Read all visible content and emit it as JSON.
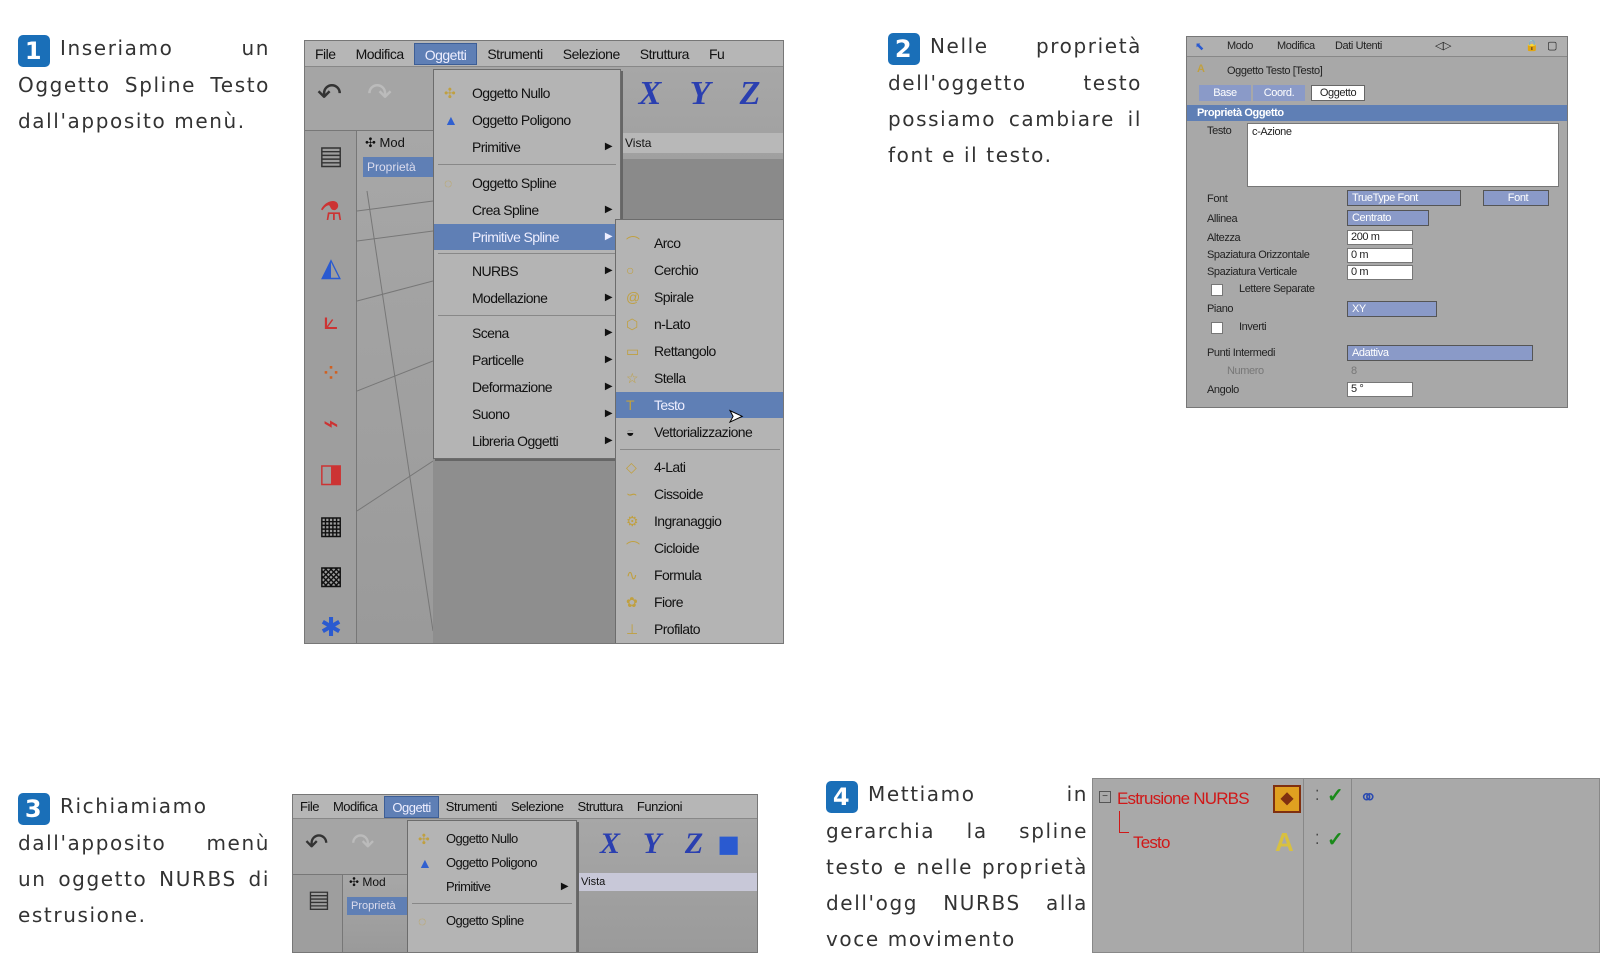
{
  "steps": [
    {
      "num": "1",
      "text": "Inseriamo un Oggetto Spline Testo dall'apposito menù."
    },
    {
      "num": "2",
      "text": "Nelle proprietà dell'oggetto testo possiamo cambiare il font e il testo."
    },
    {
      "num": "3",
      "text": "Richiamiamo dall'apposito menù un oggetto NURBS di estrusione."
    },
    {
      "num": "4",
      "text": "Mettiamo in gerarchia la spline testo e nelle proprietà dell'ogg NURBS alla voce movimento"
    }
  ],
  "menubar1": [
    "File",
    "Modifica",
    "Oggetti",
    "Strumenti",
    "Selezione",
    "Struttura",
    "Fu"
  ],
  "menubar3": [
    "File",
    "Modifica",
    "Oggetti",
    "Strumenti",
    "Selezione",
    "Struttura",
    "Funzioni"
  ],
  "viewport": {
    "tab": "Mod",
    "props_tab": "Proprietà",
    "vista": "Vista"
  },
  "axes": [
    "X",
    "Y",
    "Z"
  ],
  "oggetti_menu": [
    "Oggetto Nullo",
    "Oggetto Poligono",
    "Primitive",
    "Oggetto Spline",
    "Crea Spline",
    "Primitive Spline",
    "NURBS",
    "Modellazione",
    "Scena",
    "Particelle",
    "Deformazione",
    "Suono",
    "Libreria Oggetti"
  ],
  "spline_submenu": [
    "Arco",
    "Cerchio",
    "Spirale",
    "n-Lato",
    "Rettangolo",
    "Stella",
    "Testo",
    "Vettorializzazione",
    "4-Lati",
    "Cissoide",
    "Ingranaggio",
    "Cicloide",
    "Formula",
    "Fiore",
    "Profilato"
  ],
  "props": {
    "header": [
      "Modo",
      "Modifica",
      "Dati Utenti"
    ],
    "object_title": "Oggetto Testo [Testo]",
    "tabs": [
      "Base",
      "Coord.",
      "Oggetto"
    ],
    "section": "Proprietà Oggetto",
    "testo_label": "Testo",
    "testo_value": "c-Azione",
    "rows": [
      {
        "label": "Font",
        "value": "TrueType Font"
      },
      {
        "label": "Allinea",
        "value": "Centrato"
      },
      {
        "label": "Altezza",
        "value": "200 m"
      },
      {
        "label": "Spaziatura Orizzontale",
        "value": "0 m"
      },
      {
        "label": "Spaziatura Verticale",
        "value": "0 m"
      },
      {
        "label": "Lettere Separate",
        "value": ""
      },
      {
        "label": "Piano",
        "value": "XY"
      },
      {
        "label": "Inverti",
        "value": ""
      },
      {
        "label": "Punti Intermedi",
        "value": "Adattiva"
      },
      {
        "label": "Numero",
        "value": "8"
      },
      {
        "label": "Angolo",
        "value": "5 °"
      }
    ],
    "font_button": "Font"
  },
  "hierarchy": {
    "parent": "Estrusione NURBS",
    "child": "Testo"
  }
}
